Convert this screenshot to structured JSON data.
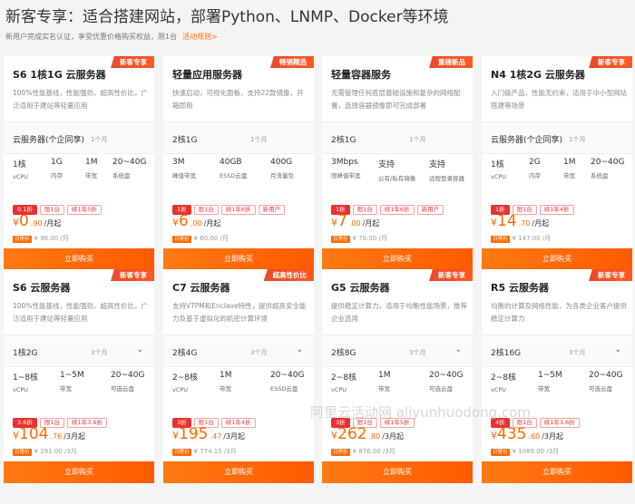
{
  "header": {
    "title": "新客专享：适合搭建网站，部署Python、LNMP、Docker等环境",
    "subtitle": "新用户完成实名认证，享受优惠价格购买权益，限1台",
    "rules_link": "活动规则>"
  },
  "buy_label": "立即购买",
  "orig_badge": "日常价",
  "cards": [
    {
      "ribbon": "新客专享",
      "title": "S6 1核1G 云服务器",
      "desc": "100%性能基线，性能强劲，超高性价比，广泛适用于建站等轻量应用",
      "sel_value": "云服务器(个企同享)",
      "sel_duration": "1个月",
      "chevron": "",
      "specs": [
        {
          "v": "1核",
          "l": "vCPU"
        },
        {
          "v": "1G",
          "l": "内存"
        },
        {
          "v": "1M",
          "l": "带宽"
        },
        {
          "v": "20~40G",
          "l": "系统盘"
        }
      ],
      "tags": [
        "0.1折",
        "限1台",
        "续1年5折"
      ],
      "price_int": "0",
      "price_dec": ".90",
      "price_unit": "/月起",
      "orig": "¥ 96.00 /月"
    },
    {
      "ribbon": "畅销精选",
      "title": "轻量应用服务器",
      "desc": "快速启动，可视化面板，支持22款镜像，开箱即用",
      "sel_value": "2核1G",
      "sel_duration": "1个月",
      "chevron": "",
      "specs": [
        {
          "v": "3M",
          "l": "峰值带宽"
        },
        {
          "v": "40GB",
          "l": "ESSD云盘"
        },
        {
          "v": "400G",
          "l": "月流量包"
        }
      ],
      "tags": [
        "1折",
        "限1台",
        "续1年6折",
        "新用户"
      ],
      "price_int": "6",
      "price_dec": ".00",
      "price_unit": "/月起",
      "orig": "¥ 60.00 /月"
    },
    {
      "ribbon": "重磅新品",
      "title": "轻量容器服务",
      "desc": "无需管理任何底层基础设施和复杂的网络配置，选择容器镜像即可完成部署",
      "sel_value": "2核1G",
      "sel_duration": "1个月",
      "chevron": "",
      "specs": [
        {
          "v": "3Mbps",
          "l": "限峰值带宽"
        },
        {
          "v": "支持",
          "l": "公有/私有镜像"
        },
        {
          "v": "支持",
          "l": "远程登录容器"
        }
      ],
      "tags": [
        "1折",
        "限1台",
        "续1年6折",
        "新用户"
      ],
      "price_int": "7",
      "price_dec": ".00",
      "price_unit": "/月起",
      "orig": "¥ 70.00 /月"
    },
    {
      "ribbon": "新客专享",
      "title": "N4 1核2G 云服务器",
      "desc": "入门级产品，性能无约束，适用于中小型网站搭建等场景",
      "sel_value": "云服务器(个企同享)",
      "sel_duration": "1个月",
      "chevron": "",
      "specs": [
        {
          "v": "1核",
          "l": "vCPU"
        },
        {
          "v": "2G",
          "l": "内存"
        },
        {
          "v": "1M",
          "l": "带宽"
        },
        {
          "v": "20~40G",
          "l": "系统盘"
        }
      ],
      "tags": [
        "1折",
        "限1台",
        "续1年4折"
      ],
      "price_int": "14",
      "price_dec": ".70",
      "price_unit": "/月起",
      "orig": "¥ 147.00 /月"
    },
    {
      "ribbon": "新客专享",
      "title": "S6 云服务器",
      "desc": "100%性能基线，性能强劲，超高性价比，广泛适用于建站等轻量应用",
      "sel_value": "1核2G",
      "sel_duration": "3个月",
      "chevron": "⌄",
      "specs": [
        {
          "v": "1~8核",
          "l": "vCPU"
        },
        {
          "v": "1~5M",
          "l": "带宽"
        },
        {
          "v": "20~40G",
          "l": "可选云盘"
        }
      ],
      "tags": [
        "3.6折",
        "限1台",
        "续1年3.6折"
      ],
      "price_int": "104",
      "price_dec": ".76",
      "price_unit": "/3月起",
      "orig": "¥ 291.00 /3月"
    },
    {
      "ribbon": "超高性价比",
      "title": "C7 云服务器",
      "desc": "支持VTPM和Enclave特性，提供超高安全能力及基于虚拟化的机密计算环境",
      "sel_value": "2核4G",
      "sel_duration": "3个月",
      "chevron": "⌄",
      "specs": [
        {
          "v": "2~8核",
          "l": "vCPU"
        },
        {
          "v": "1M",
          "l": "带宽"
        },
        {
          "v": "20~40G",
          "l": "ESSD云盘"
        }
      ],
      "tags": [
        "3折",
        "限1台",
        "续1年4折"
      ],
      "price_int": "195",
      "price_dec": ".47",
      "price_unit": "/3月起",
      "orig": "¥ 774.15 /3月"
    },
    {
      "ribbon": "新客专享",
      "title": "G5 云服务器",
      "desc": "提供稳定计算力，适用于均衡性能场景，推荐企业选用",
      "sel_value": "2核8G",
      "sel_duration": "3个月",
      "chevron": "⌄",
      "specs": [
        {
          "v": "2~8核",
          "l": "vCPU"
        },
        {
          "v": "1M",
          "l": "带宽"
        },
        {
          "v": "20~40G",
          "l": "可选云盘"
        }
      ],
      "tags": [
        "3折",
        "限1台",
        "续1年5折"
      ],
      "price_int": "262",
      "price_dec": ".80",
      "price_unit": "/3月起",
      "orig": "¥ 876.00 /3月"
    },
    {
      "ribbon": "新客专享",
      "title": "R5 云服务器",
      "desc": "均衡的计算及网络性能，为各类企业客户提供稳定计算力",
      "sel_value": "2核16G",
      "sel_duration": "3个月",
      "chevron": "⌄",
      "specs": [
        {
          "v": "2~8核",
          "l": "vCPU"
        },
        {
          "v": "1~5M",
          "l": "带宽"
        },
        {
          "v": "20~40G",
          "l": "可选云盘"
        }
      ],
      "tags": [
        "4折",
        "限1台",
        "续1年3.6折"
      ],
      "price_int": "435",
      "price_dec": ".60",
      "price_unit": "/3月起",
      "orig": "¥ 1089.00 /3月"
    }
  ],
  "watermark": "阿里云活动网 aliyunhuodong.com"
}
